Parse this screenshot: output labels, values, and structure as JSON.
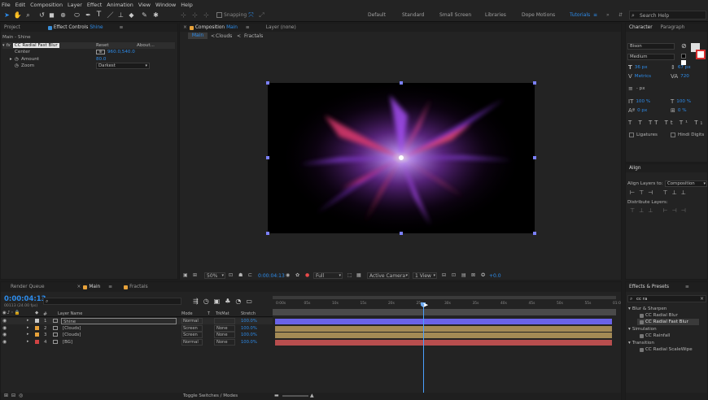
{
  "menu": [
    "File",
    "Edit",
    "Composition",
    "Layer",
    "Effect",
    "Animation",
    "View",
    "Window",
    "Help"
  ],
  "toolbar": {
    "snapping_label": "Snapping",
    "workspaces": [
      "Default",
      "Standard",
      "Small Screen",
      "Libraries",
      "Dope Motions",
      "Tutorials"
    ],
    "active_workspace": "Tutorials",
    "search_placeholder": "Search Help"
  },
  "project_panel": {
    "tab_project": "Project",
    "tab_effect_controls": "Effect Controls",
    "tab_layer_name": "Shine",
    "breadcrumb": "Main - Shine",
    "effect_name": "CC Radial Fast Blur",
    "reset_label": "Reset",
    "about_label": "About...",
    "props": [
      {
        "name": "Center",
        "value": "960.0,540.0"
      },
      {
        "name": "Amount",
        "value": "80.0"
      },
      {
        "name": "Zoom",
        "value": "Darkest"
      }
    ]
  },
  "composition": {
    "tab_label": "Composition",
    "tab_comp_name": "Main",
    "layer_tab": "Layer (none)",
    "flow": [
      "Main",
      "Clouds",
      "Fractals"
    ],
    "zoom": "50%",
    "timecode": "0:00:04:13",
    "resolution": "Full",
    "camera": "Active Camera",
    "view": "1 View",
    "exposure": "+0.0"
  },
  "character": {
    "tab_character": "Character",
    "tab_paragraph": "Paragraph",
    "font": "Bison",
    "style": "Medium",
    "size": "36 px",
    "leading": "67 px",
    "kerning": "Metrics",
    "tracking": "720",
    "stroke": "- px",
    "vscale": "100 %",
    "hscale": "100 %",
    "baseline": "0 px",
    "tsume": "0 %",
    "ligatures": "Ligatures",
    "hindi": "Hindi Digits"
  },
  "align": {
    "title": "Align",
    "align_to_label": "Align Layers to:",
    "align_to_value": "Composition",
    "distribute_label": "Distribute Layers:"
  },
  "effects_presets": {
    "title": "Effects & Presets",
    "search_value": "cc ra",
    "groups": [
      {
        "name": "Blur & Sharpen",
        "items": [
          "CC Radial Blur",
          "CC Radial Fast Blur"
        ]
      },
      {
        "name": "Simulation",
        "items": [
          "CC Rainfall"
        ]
      },
      {
        "name": "Transition",
        "items": [
          "CC Radial ScaleWipe"
        ]
      }
    ]
  },
  "timeline": {
    "tab_render_queue": "Render Queue",
    "tab_main": "Main",
    "tab_fractals": "Fractals",
    "timecode": "0:00:04:13",
    "frame_info": "00113 (24.00 fps)",
    "headers": {
      "layer_name": "Layer Name",
      "mode": "Mode",
      "t": "T",
      "trkmat": "TrkMat",
      "stretch": "Stretch"
    },
    "ruler": [
      "0:00s",
      "05s",
      "10s",
      "15s",
      "20s",
      "25s",
      "30s",
      "35s",
      "40s",
      "45s",
      "50s",
      "55s",
      "01:0"
    ],
    "layers": [
      {
        "num": "1",
        "name": "Shine",
        "mode": "Normal",
        "trkmat": "",
        "stretch": "100.0%",
        "label_color": "#c9c9c9",
        "bar_color": "#6a63e8"
      },
      {
        "num": "2",
        "name": "[Clouds]",
        "mode": "Screen",
        "trkmat": "None",
        "stretch": "100.0%",
        "label_color": "#e8a23a",
        "bar_color": "#a38a55"
      },
      {
        "num": "3",
        "name": "[Clouds]",
        "mode": "Screen",
        "trkmat": "None",
        "stretch": "100.0%",
        "label_color": "#e8a23a",
        "bar_color": "#a38a55"
      },
      {
        "num": "4",
        "name": "[BG]",
        "mode": "Normal",
        "trkmat": "None",
        "stretch": "100.0%",
        "label_color": "#d14343",
        "bar_color": "#b84e4e"
      }
    ],
    "toggle_label": "Toggle Switches / Modes"
  },
  "colors": {
    "accent": "#2d8ceb",
    "panel": "#232323",
    "bg": "#1d1d1d"
  }
}
